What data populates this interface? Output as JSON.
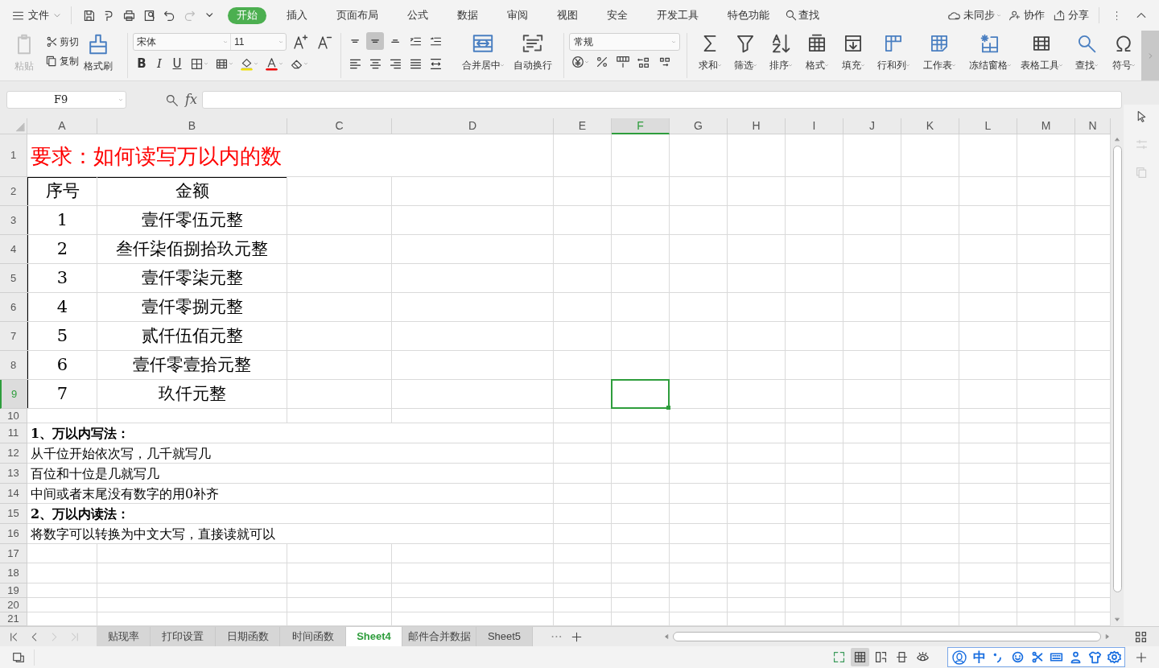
{
  "menu": {
    "file_label": "文件",
    "tabs": [
      {
        "label": "开始",
        "selected": true
      },
      {
        "label": "插入",
        "selected": false
      },
      {
        "label": "页面布局",
        "selected": false
      },
      {
        "label": "公式",
        "selected": false
      },
      {
        "label": "数据",
        "selected": false
      },
      {
        "label": "审阅",
        "selected": false
      },
      {
        "label": "视图",
        "selected": false
      },
      {
        "label": "安全",
        "selected": false
      },
      {
        "label": "开发工具",
        "selected": false
      },
      {
        "label": "特色功能",
        "selected": false
      }
    ],
    "search": "查找",
    "sync": "未同步",
    "collaborate": "协作",
    "share": "分享"
  },
  "ribbon": {
    "paste": {
      "label": "粘贴",
      "disabled": true
    },
    "cut": "剪切",
    "copy": "复制",
    "format_painter": "格式刷",
    "font_name": "宋体",
    "font_size": "11",
    "text_style_buttons": [
      "B",
      "I",
      "U"
    ],
    "vertical_align": [
      {
        "selected": false
      },
      {
        "selected": true
      },
      {
        "selected": false
      }
    ],
    "merge": "合并居中",
    "wrap": "自动换行",
    "number_format": "常规",
    "tools": [
      "求和",
      "筛选",
      "排序",
      "格式",
      "填充",
      "行和列",
      "工作表",
      "冻结窗格",
      "表格工具",
      "查找",
      "符号"
    ]
  },
  "formula_bar": {
    "name_box": "F9",
    "fx": "fx"
  },
  "columns": [
    {
      "label": "A",
      "selected": false
    },
    {
      "label": "B",
      "selected": false
    },
    {
      "label": "C",
      "selected": false
    },
    {
      "label": "D",
      "selected": false
    },
    {
      "label": "E",
      "selected": false
    },
    {
      "label": "F",
      "selected": true
    },
    {
      "label": "G",
      "selected": false
    },
    {
      "label": "H",
      "selected": false
    },
    {
      "label": "I",
      "selected": false
    },
    {
      "label": "J",
      "selected": false
    },
    {
      "label": "K",
      "selected": false
    },
    {
      "label": "L",
      "selected": false
    },
    {
      "label": "M",
      "selected": false
    },
    {
      "label": "N",
      "selected": false
    }
  ],
  "rows": [
    {
      "number": "1",
      "selected": false,
      "kind": "title",
      "cells": [
        "要求：如何读写万以内的数"
      ]
    },
    {
      "number": "2",
      "selected": false,
      "kind": "table",
      "cells": [
        "序号",
        "金额"
      ]
    },
    {
      "number": "3",
      "selected": false,
      "kind": "table",
      "cells": [
        "1",
        "壹仟零伍元整"
      ]
    },
    {
      "number": "4",
      "selected": false,
      "kind": "table",
      "cells": [
        "2",
        "叁仟柒佰捌拾玖元整"
      ]
    },
    {
      "number": "5",
      "selected": false,
      "kind": "table",
      "cells": [
        "3",
        "壹仟零柒元整"
      ]
    },
    {
      "number": "6",
      "selected": false,
      "kind": "table",
      "cells": [
        "4",
        "壹仟零捌元整"
      ]
    },
    {
      "number": "7",
      "selected": false,
      "kind": "table",
      "cells": [
        "5",
        "贰仟伍佰元整"
      ]
    },
    {
      "number": "8",
      "selected": false,
      "kind": "table",
      "cells": [
        "6",
        "壹仟零壹拾元整"
      ]
    },
    {
      "number": "9",
      "selected": true,
      "kind": "table",
      "cells": [
        "7",
        "玖仟元整"
      ]
    },
    {
      "number": "10",
      "selected": false,
      "kind": "blank"
    },
    {
      "number": "11",
      "selected": false,
      "kind": "heading",
      "cells": [
        "1、万以内写法："
      ]
    },
    {
      "number": "12",
      "selected": false,
      "kind": "note",
      "cells": [
        "从千位开始依次写，几千就写几"
      ]
    },
    {
      "number": "13",
      "selected": false,
      "kind": "note",
      "cells": [
        "百位和十位是几就写几"
      ]
    },
    {
      "number": "14",
      "selected": false,
      "kind": "note",
      "cells": [
        "中间或者末尾没有数字的用0补齐"
      ]
    },
    {
      "number": "15",
      "selected": false,
      "kind": "heading",
      "cells": [
        "2、万以内读法："
      ]
    },
    {
      "number": "16",
      "selected": false,
      "kind": "note",
      "cells": [
        "将数字可以转换为中文大写，直接读就可以"
      ]
    },
    {
      "number": "17",
      "selected": false,
      "kind": "blank"
    },
    {
      "number": "18",
      "selected": false,
      "kind": "blank"
    },
    {
      "number": "19",
      "selected": false,
      "kind": "blank"
    },
    {
      "number": "20",
      "selected": false,
      "kind": "blank"
    },
    {
      "number": "21",
      "selected": false,
      "kind": "blank"
    }
  ],
  "sheet_tabs": [
    {
      "label": "贴现率",
      "selected": false
    },
    {
      "label": "打印设置",
      "selected": false
    },
    {
      "label": "日期函数",
      "selected": false
    },
    {
      "label": "时间函数",
      "selected": false
    },
    {
      "label": "Sheet4",
      "selected": true
    },
    {
      "label": "邮件合并数据",
      "selected": false
    },
    {
      "label": "Sheet5",
      "selected": false
    }
  ],
  "view_modes": [
    {
      "selected": false
    },
    {
      "selected": true
    },
    {
      "selected": false
    },
    {
      "selected": false
    },
    {
      "selected": false
    }
  ],
  "ime": {
    "label": "中"
  }
}
